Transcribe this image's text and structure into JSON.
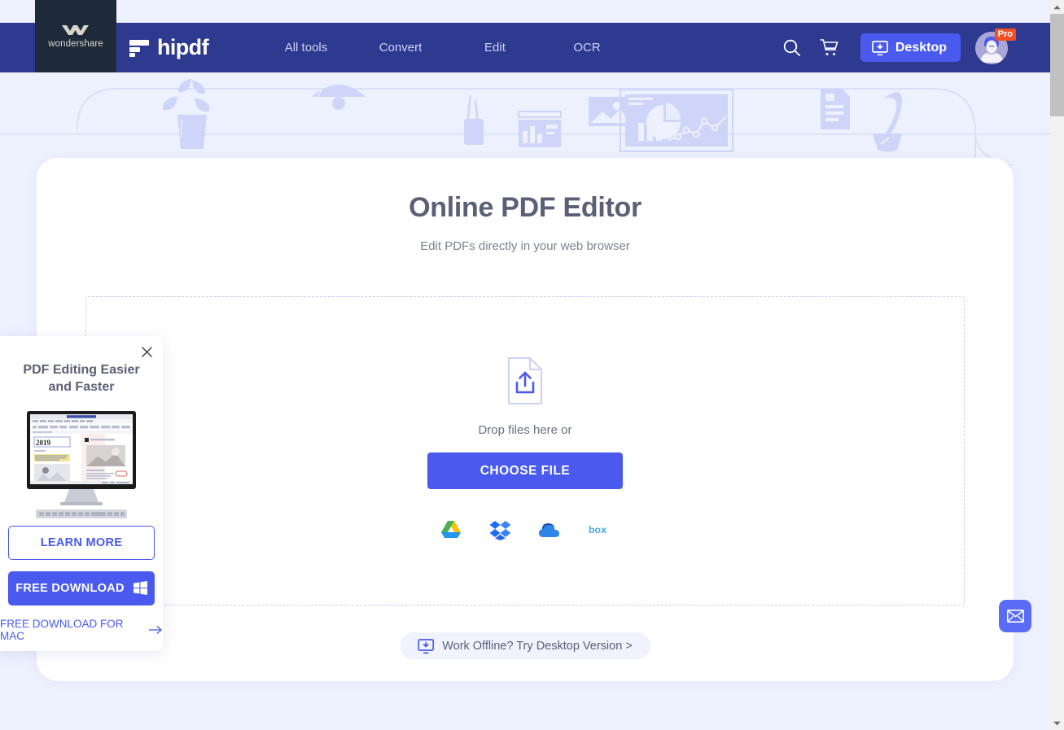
{
  "brand": {
    "wondershare_label": "wondershare",
    "product_name": "hipdf",
    "logo_icon": "hipdf-logo-icon",
    "ws_icon": "wondershare-logo-icon"
  },
  "nav": {
    "links": [
      {
        "label": "All tools"
      },
      {
        "label": "Convert"
      },
      {
        "label": "Edit"
      },
      {
        "label": "OCR"
      }
    ],
    "search_icon": "search-icon",
    "cart_icon": "cart-icon",
    "desktop_button": {
      "label": "Desktop",
      "icon": "monitor-download-icon"
    },
    "account": {
      "avatar_icon": "user-avatar-icon",
      "badge": "Pro"
    }
  },
  "hero": {
    "title": "Online PDF Editor",
    "subtitle": "Edit PDFs directly in your web browser"
  },
  "uploader": {
    "upload_icon": "file-upload-icon",
    "drop_text": "Drop files here or",
    "choose_button": "CHOOSE FILE",
    "cloud_sources": [
      {
        "name": "Google Drive",
        "icon": "google-drive-icon"
      },
      {
        "name": "Dropbox",
        "icon": "dropbox-icon"
      },
      {
        "name": "OneDrive",
        "icon": "onedrive-icon"
      },
      {
        "name": "Box",
        "icon": "box-icon"
      }
    ]
  },
  "offline": {
    "label": "Work Offline? Try Desktop Version >",
    "icon": "monitor-download-icon"
  },
  "promo": {
    "close_icon": "close-icon",
    "title": "PDF Editing Easier and Faster",
    "image_alt": "desktop-monitor-preview",
    "learn_more": "LEARN MORE",
    "free_download": "FREE DOWNLOAD",
    "windows_icon": "windows-logo-icon",
    "mac_link": "FREE DOWNLOAD FOR MAC",
    "mac_arrow_icon": "arrow-right-icon"
  },
  "fab": {
    "mail_icon": "envelope-icon"
  },
  "scrollbar": {
    "up_icon": "scroll-up-arrow-icon",
    "down_icon": "scroll-down-arrow-icon"
  },
  "colors": {
    "navbar": "#2d3a90",
    "page_bg": "#edf0fd",
    "accent": "#4a5aef",
    "pro_badge": "#f04e23",
    "ws_dark": "#1e2a3a",
    "heading": "#5b6076",
    "deco": "#ced5f8"
  }
}
